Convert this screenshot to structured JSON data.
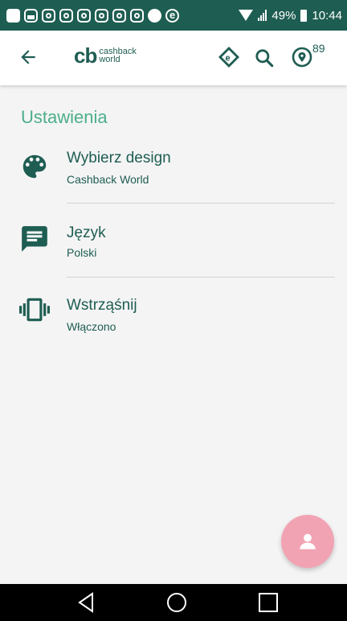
{
  "status_bar": {
    "battery_percent": "49%",
    "time": "10:44",
    "notification_icons": [
      "message-icon",
      "image-icon",
      "instagram-icon",
      "instagram-icon",
      "instagram-icon",
      "instagram-icon",
      "instagram-icon",
      "instagram-icon",
      "messenger-icon",
      "e-icon"
    ]
  },
  "app_bar": {
    "logo_mark": "cb",
    "logo_line1": "cashback",
    "logo_line2": "world",
    "location_count": "89"
  },
  "settings": {
    "title": "Ustawienia",
    "items": [
      {
        "label": "Wybierz design",
        "value": "Cashback World",
        "icon": "palette-icon"
      },
      {
        "label": "Język",
        "value": "Polski",
        "icon": "chat-icon"
      },
      {
        "label": "Wstrząśnij",
        "value": "Włączono",
        "icon": "vibrate-icon"
      }
    ]
  },
  "colors": {
    "primary": "#1e5d52",
    "accent": "#4caf8a",
    "fab": "#f2a3b3"
  }
}
